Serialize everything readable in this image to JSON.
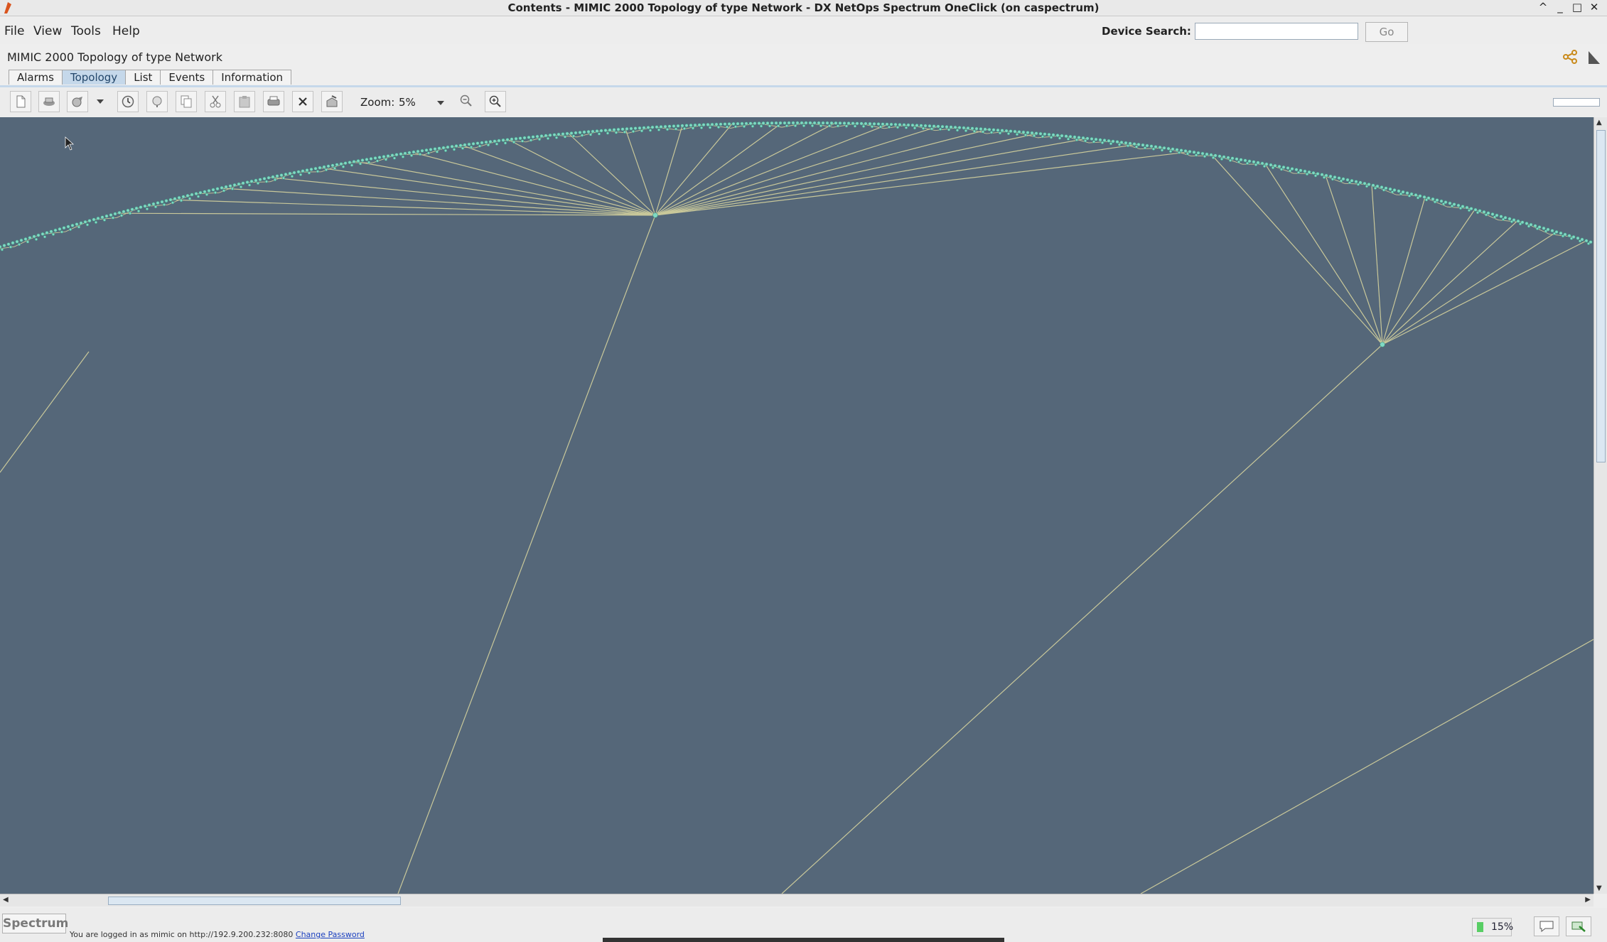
{
  "window": {
    "title": "Contents - MIMIC 2000 Topology of type Network - DX NetOps Spectrum OneClick (on caspectrum)",
    "controls": [
      "^",
      "_",
      "□",
      "✕"
    ]
  },
  "menu": [
    {
      "label": "File"
    },
    {
      "label": "View"
    },
    {
      "label": "Tools"
    },
    {
      "label": "Help"
    }
  ],
  "search": {
    "label": "Device Search:",
    "value": "",
    "go_label": "Go"
  },
  "view_title": "MIMIC 2000 Topology of type Network",
  "tabs": [
    {
      "label": "Alarms",
      "active": false
    },
    {
      "label": "Topology",
      "active": true
    },
    {
      "label": "List",
      "active": false
    },
    {
      "label": "Events",
      "active": false
    },
    {
      "label": "Information",
      "active": false
    }
  ],
  "toolbar": {
    "zoom_label": "Zoom:",
    "zoom_value": "5%",
    "icons": [
      "new-doc-icon",
      "import-icon",
      "edit-icon",
      "dropdown-arrow-icon",
      "clock-icon",
      "find-icon",
      "copy-icon",
      "cut-icon",
      "paste-icon",
      "print-icon",
      "delete-icon",
      "export-icon",
      "zoom-out-icon",
      "zoom-in-icon"
    ]
  },
  "topology": {
    "background": "#556779",
    "link_color": "#c9c89a",
    "node_color": "#7fd9c3"
  },
  "status": {
    "brand": "Spectrum",
    "login_text": "You are logged in as mimic on http://192.9.200.232:8080",
    "change_password": "Change Password",
    "memory_percent": "15%",
    "memory_level": 0.15
  }
}
